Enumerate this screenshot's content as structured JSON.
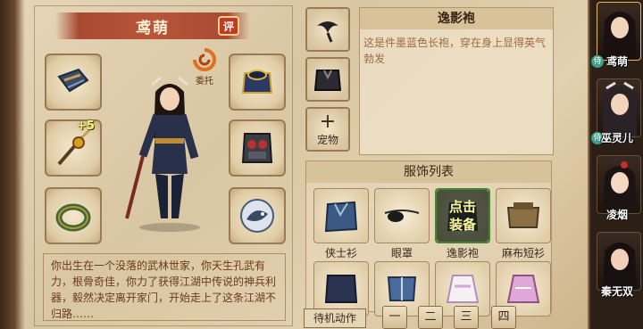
{
  "character": {
    "name": "鸢萌",
    "rate_label": "评",
    "entrust_label": "委托",
    "caption": "",
    "bio": "你出生在一个没落的武林世家，你天生孔武有力，根骨奇佳，你力了获得江湖中传说的神兵利器，毅然决定离开家门，开始走上了这条江湖不归路……",
    "weapon_bonus": "+5"
  },
  "equipment_slots": [
    {
      "name": "bracer",
      "icon": "bracer-icon"
    },
    {
      "name": "weapon",
      "icon": "sword-icon"
    },
    {
      "name": "ring",
      "icon": "ring-icon"
    },
    {
      "name": "armor",
      "icon": "armor-icon"
    },
    {
      "name": "chest",
      "icon": "chest-plate-icon"
    },
    {
      "name": "accessory",
      "icon": "fish-charm-icon"
    }
  ],
  "side_slots": {
    "slot1_icon": "hair-icon",
    "slot2_icon": "outfit-icon",
    "pet_label": "宠物"
  },
  "detail": {
    "title": "逸影袍",
    "description": "这是件墨蓝色长袍，穿在身上显得英气勃发"
  },
  "costume_list": {
    "title": "服饰列表",
    "items": [
      {
        "name": "侠士衫",
        "icon": "blue-robe-icon"
      },
      {
        "name": "眼罩",
        "icon": "eyepatch-icon"
      },
      {
        "name": "逸影袍",
        "icon": "dark-robe-icon",
        "selected": true
      },
      {
        "name": "麻布短衫",
        "icon": "brown-shirt-icon"
      },
      {
        "name": "",
        "icon": "navy-robe-icon"
      },
      {
        "name": "",
        "icon": "blue-vest-icon"
      },
      {
        "name": "",
        "icon": "white-dress-icon"
      },
      {
        "name": "",
        "icon": "pink-dress-icon"
      }
    ],
    "equip_line1": "点击",
    "equip_line2": "装备"
  },
  "idle_action_label": "待机动作",
  "pages": [
    "一",
    "二",
    "三",
    "四"
  ],
  "roster": [
    {
      "name": "鸢萌",
      "badge": "侍",
      "active": true
    },
    {
      "name": "巫灵儿",
      "badge": "侍"
    },
    {
      "name": "凌烟",
      "badge": ""
    },
    {
      "name": "秦无双",
      "badge": ""
    }
  ]
}
